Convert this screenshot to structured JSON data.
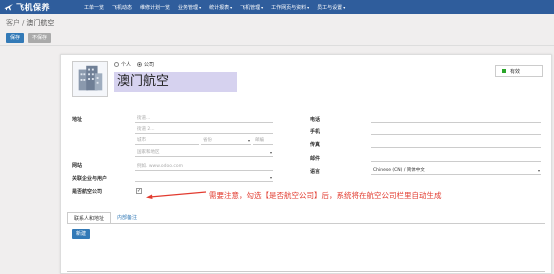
{
  "nav": {
    "brand": "飞机保养",
    "items": [
      {
        "label": "工单一览",
        "dropdown": false
      },
      {
        "label": "飞机动态",
        "dropdown": false
      },
      {
        "label": "维修计划一览",
        "dropdown": false
      },
      {
        "label": "业务管理",
        "dropdown": true
      },
      {
        "label": "统计报表",
        "dropdown": true
      },
      {
        "label": "飞机管理",
        "dropdown": true
      },
      {
        "label": "工作网页与资料",
        "dropdown": true
      },
      {
        "label": "员工与设置",
        "dropdown": true
      }
    ]
  },
  "breadcrumb": {
    "parent": "客户",
    "current": "澳门航空"
  },
  "actions": {
    "save": "保存",
    "discard": "不保存"
  },
  "form": {
    "type_person": "个人",
    "type_company": "公司",
    "name": "澳门航空",
    "active_label": "有效",
    "left": {
      "address_label": "地址",
      "street_ph": "街道...",
      "street2_ph": "街道 2...",
      "city_ph": "城市",
      "state_ph": "省份",
      "zip_ph": "邮编",
      "country_ph": "国家和地区",
      "website_label": "网站",
      "website_ph": "例如. www.odoo.com",
      "related_user_label": "关联企业与用户",
      "is_airline_label": "是否航空公司",
      "is_airline_checked": true
    },
    "right": {
      "phone_label": "电话",
      "mobile_label": "手机",
      "fax_label": "传真",
      "email_label": "邮件",
      "lang_label": "语言",
      "lang_value": "Chinese (CN) / 简体中文"
    }
  },
  "annotation": "需要注意，勾选【是否航空公司】后，系统将在航空公司栏里自动生成",
  "tabs": {
    "contacts": "联系人和地址",
    "notes": "内部备注"
  },
  "new_button": "新建",
  "colors": {
    "navbar": "#2f5d9c",
    "primary": "#337ab7",
    "annotation": "#e23b2f",
    "name_bg": "#d6d2ef",
    "active_dot": "#2aa52a"
  }
}
